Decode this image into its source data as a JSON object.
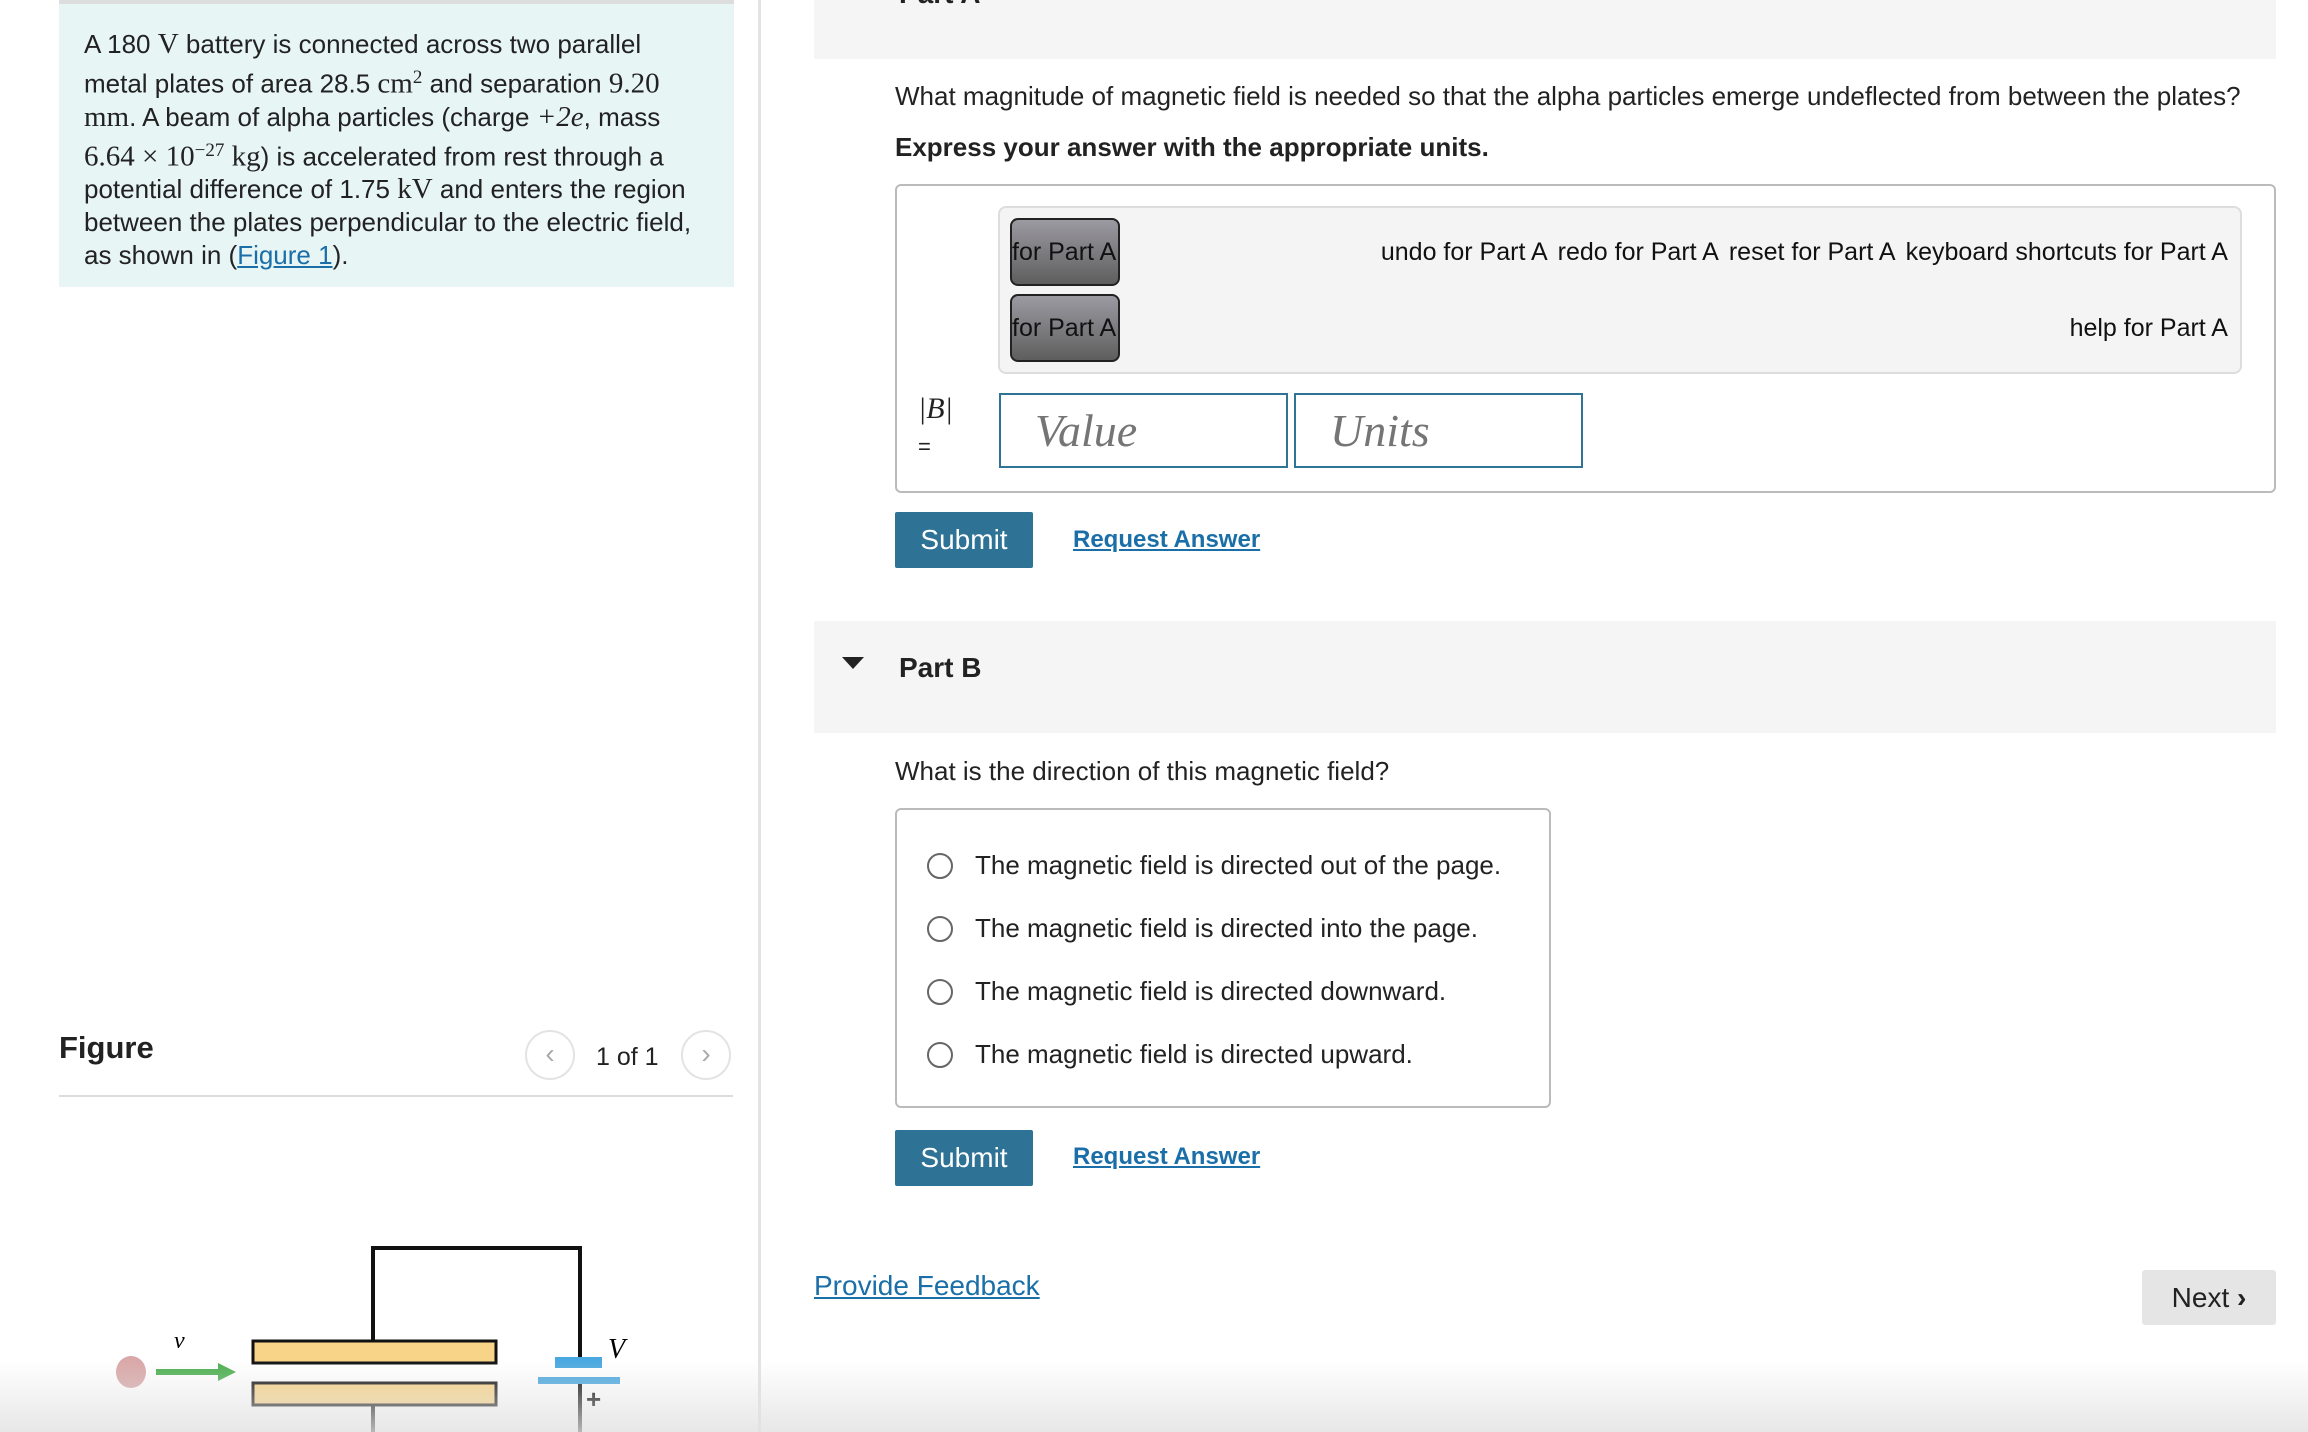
{
  "problem": {
    "t1": "A 180 ",
    "v": "V",
    "t2": " battery is connected across two parallel metal plates of area 28.5 ",
    "cm": "cm",
    "sq": "2",
    "t3": " and separation ",
    "sep": "9.20 mm",
    "t4": ". A beam of alpha particles (charge ",
    "charge": "+2e",
    "t5": ", mass ",
    "mass": "6.64 × 10",
    "exp": "−27",
    "kg": " kg",
    "t6": ") is accelerated from rest through a potential difference of 1.75 ",
    "kv": "kV",
    "t7": " and enters the region between the plates perpendicular to the electric field, as shown in (",
    "fig_link": "Figure 1",
    "t8": ")."
  },
  "figure": {
    "title": "Figure",
    "count": "1 of 1",
    "prev": "‹",
    "next": "›",
    "label_v": "v",
    "label_V": "V",
    "plus": "+",
    "colors": {
      "plates": "#f8d488",
      "arrow": "#4caf50",
      "battery": "#4aa8e0",
      "particle": "#d9a8a8"
    }
  },
  "partA": {
    "header": "Part A",
    "question": "What magnitude of magnetic field is needed so that the alpha particles emerge undeflected from between the plates?",
    "instruction": "Express your answer with the appropriate units.",
    "toolbar": {
      "btn1": "for Part A",
      "btn2": "for Part A",
      "undo": "undo for Part A",
      "redo": "redo for Part A",
      "reset": "reset for Part A",
      "shortcuts": "keyboard shortcuts for Part A",
      "help": "help for Part A"
    },
    "label": "|B|",
    "eq": "=",
    "value_placeholder": "Value",
    "units_placeholder": "Units",
    "submit": "Submit",
    "request": "Request Answer"
  },
  "partB": {
    "header": "Part B",
    "question": "What is the direction of this magnetic field?",
    "options": [
      "The magnetic field is directed out of the page.",
      "The magnetic field is directed into the page.",
      "The magnetic field is directed downward.",
      "The magnetic field is directed upward."
    ],
    "submit": "Submit",
    "request": "Request Answer"
  },
  "footer": {
    "feedback": "Provide Feedback",
    "next": "Next"
  },
  "colors": {
    "accent": "#2e7396",
    "link": "#1b6fa8"
  }
}
